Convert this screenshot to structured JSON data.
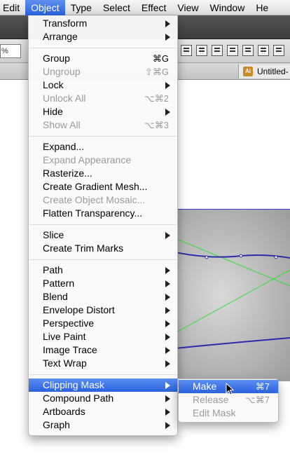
{
  "menubar": {
    "items": [
      "Edit",
      "Object",
      "Type",
      "Select",
      "Effect",
      "View",
      "Window",
      "He"
    ],
    "active_index": 1
  },
  "controlbar": {
    "percent_field": "%"
  },
  "document_tab": {
    "label": "Untitled-"
  },
  "object_menu": {
    "groups": [
      [
        {
          "label": "Transform",
          "submenu": true
        },
        {
          "label": "Arrange",
          "submenu": true
        }
      ],
      [
        {
          "label": "Group",
          "shortcut": "⌘G"
        },
        {
          "label": "Ungroup",
          "shortcut": "⇧⌘G",
          "disabled": true
        },
        {
          "label": "Lock",
          "submenu": true
        },
        {
          "label": "Unlock All",
          "shortcut": "⌥⌘2",
          "disabled": true
        },
        {
          "label": "Hide",
          "submenu": true
        },
        {
          "label": "Show All",
          "shortcut": "⌥⌘3",
          "disabled": true
        }
      ],
      [
        {
          "label": "Expand..."
        },
        {
          "label": "Expand Appearance",
          "disabled": true
        },
        {
          "label": "Rasterize..."
        },
        {
          "label": "Create Gradient Mesh..."
        },
        {
          "label": "Create Object Mosaic...",
          "disabled": true
        },
        {
          "label": "Flatten Transparency..."
        }
      ],
      [
        {
          "label": "Slice",
          "submenu": true
        },
        {
          "label": "Create Trim Marks"
        }
      ],
      [
        {
          "label": "Path",
          "submenu": true
        },
        {
          "label": "Pattern",
          "submenu": true
        },
        {
          "label": "Blend",
          "submenu": true
        },
        {
          "label": "Envelope Distort",
          "submenu": true
        },
        {
          "label": "Perspective",
          "submenu": true
        },
        {
          "label": "Live Paint",
          "submenu": true
        },
        {
          "label": "Image Trace",
          "submenu": true
        },
        {
          "label": "Text Wrap",
          "submenu": true
        }
      ],
      [
        {
          "label": "Clipping Mask",
          "submenu": true,
          "highlight": true
        },
        {
          "label": "Compound Path",
          "submenu": true
        },
        {
          "label": "Artboards",
          "submenu": true
        },
        {
          "label": "Graph",
          "submenu": true
        }
      ]
    ]
  },
  "clipping_mask_submenu": {
    "items": [
      {
        "label": "Make",
        "shortcut": "⌘7",
        "highlight": true
      },
      {
        "label": "Release",
        "shortcut": "⌥⌘7",
        "disabled": true
      },
      {
        "label": "Edit Mask",
        "disabled": true
      }
    ]
  },
  "colors": {
    "highlight": "#2a62df",
    "path_blue": "#2c2ca8",
    "guide_green": "#33dd33"
  }
}
